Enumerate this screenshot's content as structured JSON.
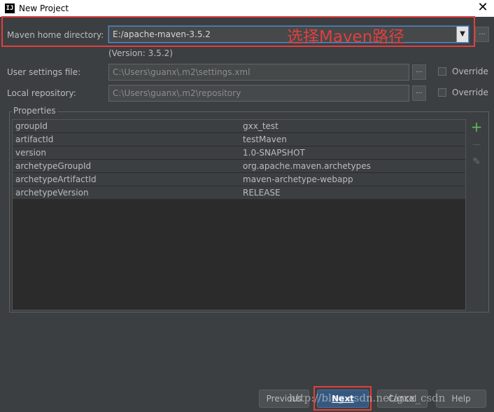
{
  "window": {
    "title": "New Project",
    "app_icon": "IJ",
    "close_glyph": "✕"
  },
  "maven_home": {
    "label": "Maven home directory:",
    "value": "E:/apache-maven-3.5.2",
    "annotation": "选择Maven路径",
    "version": "(Version: 3.5.2)"
  },
  "user_settings": {
    "label": "User settings file:",
    "value": "C:\\Users\\guanx\\.m2\\settings.xml",
    "override_label": "Override",
    "override_checked": false
  },
  "local_repo": {
    "label": "Local repository:",
    "value": "C:\\Users\\guanx\\.m2\\repository",
    "override_label": "Override",
    "override_checked": false
  },
  "browse_glyph": "...",
  "properties": {
    "title": "Properties",
    "rows": [
      {
        "key": "groupId",
        "value": "gxx_test"
      },
      {
        "key": "artifactId",
        "value": "testMaven"
      },
      {
        "key": "version",
        "value": "1.0-SNAPSHOT"
      },
      {
        "key": "archetypeGroupId",
        "value": "org.apache.maven.archetypes"
      },
      {
        "key": "archetypeArtifactId",
        "value": "maven-archetype-webapp"
      },
      {
        "key": "archetypeVersion",
        "value": "RELEASE"
      }
    ],
    "tools": {
      "add": "+",
      "remove": "—",
      "edit": "✎"
    }
  },
  "buttons": {
    "previous": "Previous",
    "next": "Next",
    "cancel": "Cancel",
    "help": "Help"
  },
  "watermark": "http://blog.csdn.net/gxx_csdn",
  "colors": {
    "accent_red": "#e33e3e",
    "add_green": "#5fb85f",
    "primary_blue": "#365880"
  }
}
